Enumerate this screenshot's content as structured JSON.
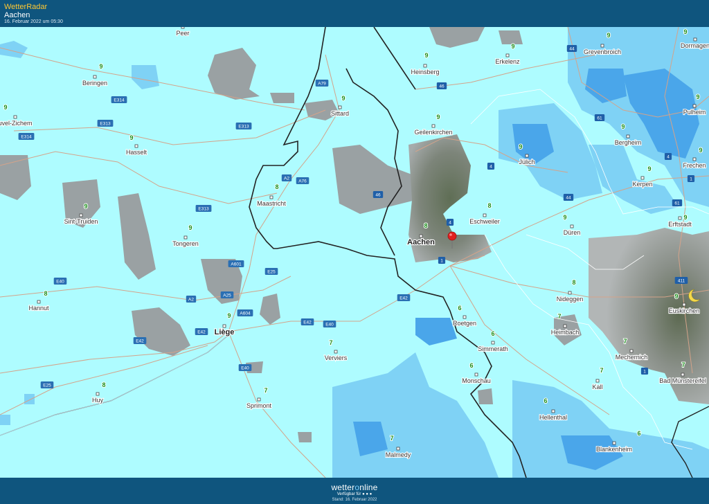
{
  "header": {
    "brand": "WetterRadar",
    "location": "Aachen",
    "timestamp": "16. Februar 2022 um 05:30"
  },
  "footer": {
    "logo_part1": "wetter",
    "logo_part2": "o",
    "logo_part3": "nline",
    "available": "Verfügbar für",
    "stand": "Stand: 16. Februar 2022"
  },
  "colors": {
    "header": "#0f557e",
    "land": "#aefcff",
    "rain_light": "#7fd2f5",
    "rain_medium": "#4aa6ea",
    "cloud": "#9aa1a3",
    "temp_text": "#1a8c1a",
    "marker": "#e02020"
  },
  "icons": [
    "location-pin-icon",
    "moon-icon"
  ],
  "cities": [
    {
      "name": "Peer",
      "temp": ""
    },
    {
      "name": "Beringen",
      "temp": "9"
    },
    {
      "name": "Hasselt",
      "temp": "9"
    },
    {
      "name": "uvel-Zichem",
      "temp": "9"
    },
    {
      "name": "Sint-Truiden",
      "temp": "9"
    },
    {
      "name": "Tongeren",
      "temp": "9"
    },
    {
      "name": "Hannut",
      "temp": "8"
    },
    {
      "name": "Liège",
      "temp": "9"
    },
    {
      "name": "Huy",
      "temp": "8"
    },
    {
      "name": "Sprimont",
      "temp": "7"
    },
    {
      "name": "Verviers",
      "temp": "7"
    },
    {
      "name": "Maastricht",
      "temp": "8"
    },
    {
      "name": "Sittard",
      "temp": "9"
    },
    {
      "name": "Heinsberg",
      "temp": "9"
    },
    {
      "name": "Geilenkirchen",
      "temp": "9"
    },
    {
      "name": "Aachen",
      "temp": "8"
    },
    {
      "name": "Eschweiler",
      "temp": "8"
    },
    {
      "name": "Roetgen",
      "temp": "6"
    },
    {
      "name": "Simmerath",
      "temp": "6"
    },
    {
      "name": "Monschau",
      "temp": "6"
    },
    {
      "name": "Malmedy",
      "temp": "7"
    },
    {
      "name": "Erkelenz",
      "temp": "9"
    },
    {
      "name": "Jülich",
      "temp": "9"
    },
    {
      "name": "Düren",
      "temp": "9"
    },
    {
      "name": "Nideggen",
      "temp": "8"
    },
    {
      "name": "Heimbach",
      "temp": "7"
    },
    {
      "name": "Hellenthal",
      "temp": "6"
    },
    {
      "name": "Blankenheim",
      "temp": "6"
    },
    {
      "name": "Kall",
      "temp": "7"
    },
    {
      "name": "Mechernich",
      "temp": "7"
    },
    {
      "name": "Bad Münstereifel",
      "temp": "7"
    },
    {
      "name": "Euskirchen",
      "temp": "9"
    },
    {
      "name": "Erftstadt",
      "temp": "9"
    },
    {
      "name": "Kerpen",
      "temp": "9"
    },
    {
      "name": "Bergheim",
      "temp": "9"
    },
    {
      "name": "Frechen",
      "temp": "9"
    },
    {
      "name": "Pulheim",
      "temp": "9"
    },
    {
      "name": "Grevenbroich",
      "temp": "9"
    },
    {
      "name": "Dormagen",
      "temp": "9"
    }
  ],
  "roads": [
    "E314",
    "E313",
    "E314",
    "E313",
    "E313",
    "A601",
    "E40",
    "E25",
    "A25",
    "A604",
    "E42",
    "E42",
    "E25",
    "E40",
    "E42",
    "E40",
    "E42",
    "A2",
    "A79",
    "A2",
    "A76",
    "46",
    "46",
    "44",
    "4",
    "4",
    "44",
    "61",
    "4",
    "1",
    "61",
    "1",
    "1",
    "411"
  ]
}
